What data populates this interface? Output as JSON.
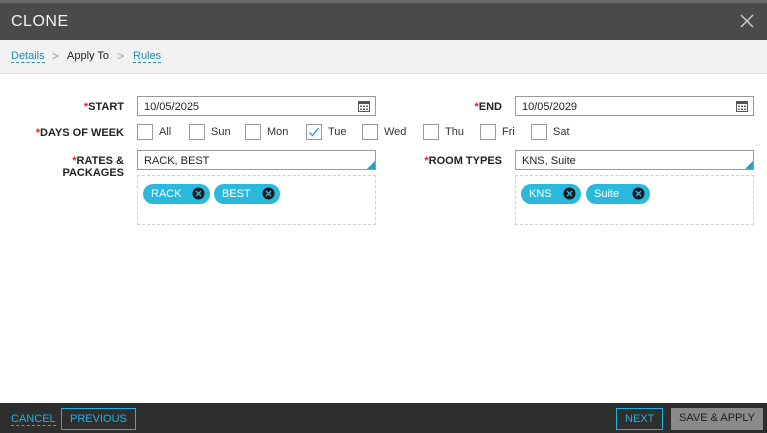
{
  "dialog": {
    "title": "CLONE"
  },
  "breadcrumb": {
    "items": [
      {
        "label": "Details"
      },
      {
        "label": "Apply To"
      },
      {
        "label": "Rules"
      }
    ],
    "separator": ">"
  },
  "form": {
    "required_marker": "*",
    "start": {
      "label": "START",
      "value": "10/05/2025"
    },
    "end": {
      "label": "END",
      "value": "10/05/2029"
    },
    "days_of_week": {
      "label": "DAYS OF WEEK",
      "days": [
        {
          "label": "All",
          "checked": false
        },
        {
          "label": "Sun",
          "checked": false
        },
        {
          "label": "Mon",
          "checked": false
        },
        {
          "label": "Tue",
          "checked": true
        },
        {
          "label": "Wed",
          "checked": false
        },
        {
          "label": "Thu",
          "checked": false
        },
        {
          "label": "Fri",
          "checked": false
        },
        {
          "label": "Sat",
          "checked": false
        }
      ]
    },
    "rates_packages": {
      "label": "RATES & PACKAGES",
      "value": "RACK, BEST",
      "tags": [
        "RACK",
        "BEST"
      ]
    },
    "room_types": {
      "label": "ROOM TYPES",
      "value": "KNS, Suite",
      "tags": [
        "KNS",
        "Suite"
      ]
    }
  },
  "footer": {
    "cancel": "CANCEL",
    "previous": "PREVIOUS",
    "next": "NEXT",
    "save_apply": "SAVE & APPLY"
  },
  "colors": {
    "accent": "#2ab8dd",
    "link": "#1f8fb0",
    "required": "#d9262b",
    "titlebar": "#4a4a4a",
    "footer": "#2e2e2e"
  },
  "icons": {
    "close": "close-icon",
    "calendar": "calendar-icon",
    "tag_remove": "remove-tag-icon",
    "check": "check-icon"
  }
}
